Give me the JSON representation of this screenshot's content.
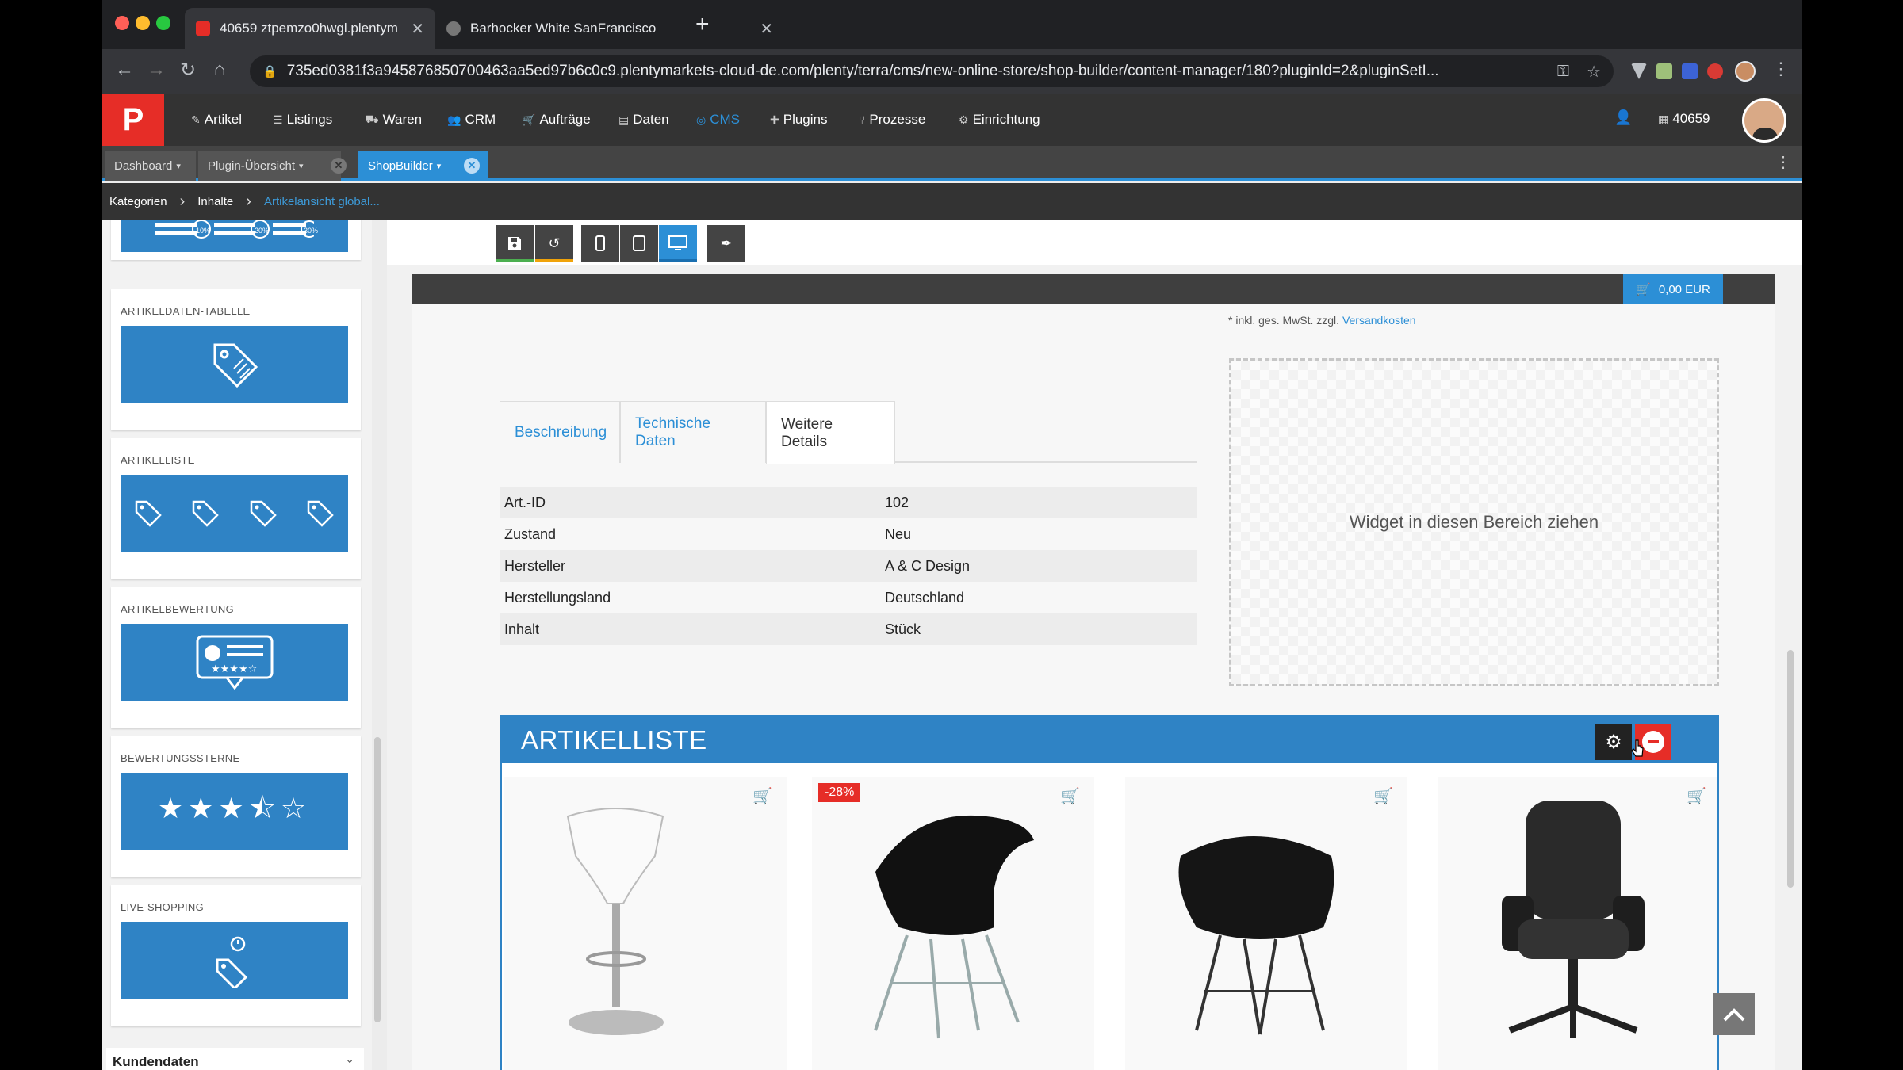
{
  "browser": {
    "tabs": [
      {
        "title": "40659 ztpemzo0hwgl.plentym"
      },
      {
        "title": "Barhocker White SanFrancisco"
      }
    ],
    "url": "735ed0381f3a945876850700463aa5ed97b6c0c9.plentymarkets-cloud-de.com/plenty/terra/cms/new-online-store/shop-builder/content-manager/180?pluginId=2&pluginSetI..."
  },
  "topnav": {
    "items": [
      {
        "label": "Artikel",
        "icon": "pencil-icon"
      },
      {
        "label": "Listings",
        "icon": "list-icon"
      },
      {
        "label": "Waren",
        "icon": "truck-icon"
      },
      {
        "label": "CRM",
        "icon": "users-icon"
      },
      {
        "label": "Aufträge",
        "icon": "cart-icon"
      },
      {
        "label": "Daten",
        "icon": "database-icon"
      },
      {
        "label": "CMS",
        "icon": "globe-icon"
      },
      {
        "label": "Plugins",
        "icon": "puzzle-icon"
      },
      {
        "label": "Prozesse",
        "icon": "flow-icon"
      },
      {
        "label": "Einrichtung",
        "icon": "gear-icon"
      }
    ],
    "active": "CMS",
    "account": "40659"
  },
  "apptabs": [
    {
      "label": "Dashboard"
    },
    {
      "label": "Plugin-Übersicht"
    },
    {
      "label": "ShopBuilder"
    }
  ],
  "breadcrumb": {
    "items": [
      "Kategorien",
      "Inhalte",
      "Artikelansicht global..."
    ]
  },
  "sidebar": {
    "widgets": [
      {
        "label": "ARTIKELDATEN-TABELLE",
        "icon": "tag-icon"
      },
      {
        "label": "ARTIKELLISTE",
        "icon": "tag-icon"
      },
      {
        "label": "ARTIKELBEWERTUNG",
        "icon": "review-icon"
      },
      {
        "label": "BEWERTUNGSSTERNE",
        "icon": "stars-icon"
      },
      {
        "label": "LIVE-SHOPPING",
        "icon": "stopwatch-tag-icon"
      }
    ],
    "discount_badges": [
      "10%",
      "20%",
      "30%"
    ],
    "section": "Kundendaten"
  },
  "shop": {
    "cart_total": "0,00 EUR",
    "mwst_note": "* inkl. ges. MwSt. zzgl.",
    "shipping_link": "Versandkosten",
    "tabs": [
      "Beschreibung",
      "Technische Daten",
      "Weitere Details"
    ],
    "active_tab": "Weitere Details",
    "details": [
      {
        "key": "Art.-ID",
        "value": "102"
      },
      {
        "key": "Zustand",
        "value": "Neu"
      },
      {
        "key": "Hersteller",
        "value": "A & C Design"
      },
      {
        "key": "Herstellungsland",
        "value": "Deutschland"
      },
      {
        "key": "Inhalt",
        "value": "Stück"
      }
    ],
    "dropzone": "Widget in diesen Bereich ziehen",
    "artikelliste": {
      "title": "ARTIKELLISTE",
      "products": [
        {
          "badge": "",
          "image": "white-bar-stool"
        },
        {
          "badge": "-28%",
          "image": "black-eiffel-chair"
        },
        {
          "badge": "",
          "image": "black-eiffel-chair"
        },
        {
          "badge": "",
          "image": "black-office-chair"
        }
      ]
    }
  },
  "colors": {
    "accent": "#2c8fd6",
    "widget_blue": "#2f83c5",
    "danger": "#e62d27",
    "nav_bg": "#333333"
  }
}
